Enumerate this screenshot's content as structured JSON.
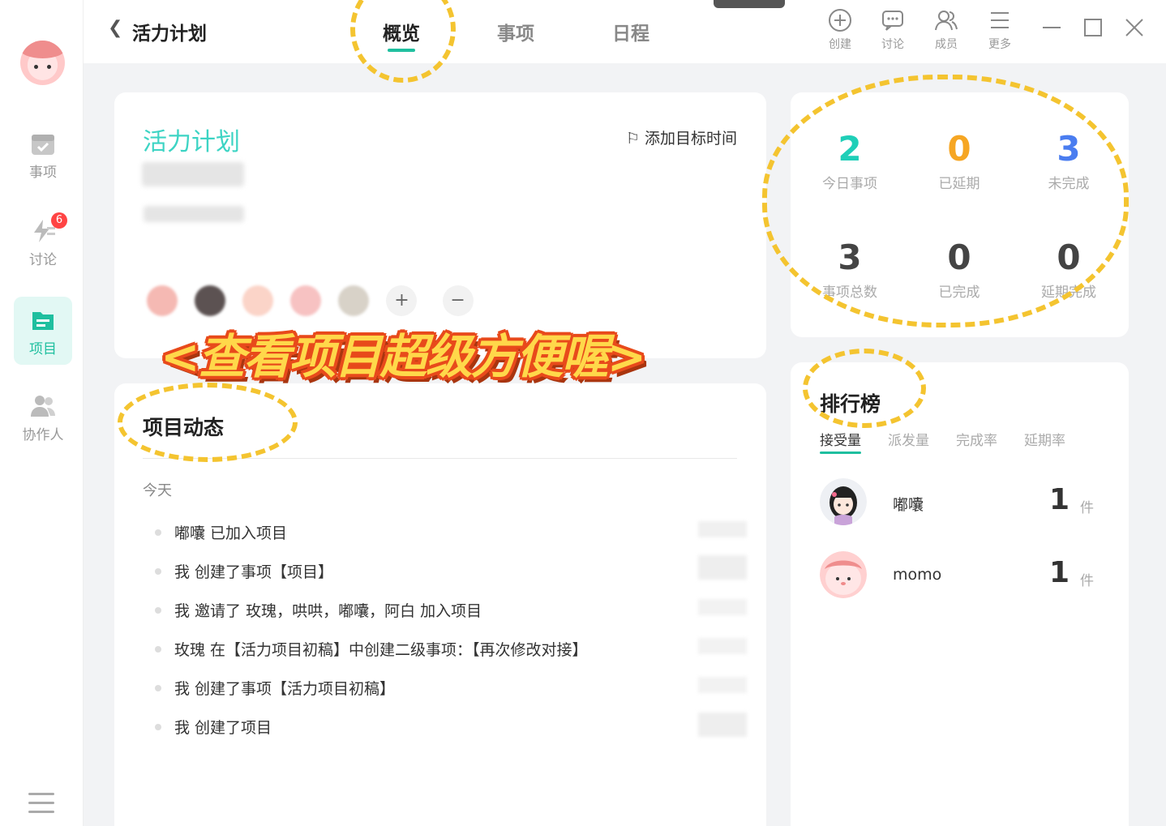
{
  "sidebar": {
    "items": [
      {
        "label": "事项",
        "badge": ""
      },
      {
        "label": "讨论",
        "badge": "6"
      },
      {
        "label": "项目",
        "badge": ""
      },
      {
        "label": "协作人",
        "badge": ""
      }
    ]
  },
  "header": {
    "project_name": "活力计划",
    "tabs": [
      "概览",
      "事项",
      "日程"
    ],
    "tools": [
      "创建",
      "讨论",
      "成员",
      "更多"
    ]
  },
  "overview": {
    "title": "活力计划",
    "add_target": "添加目标时间"
  },
  "stats": [
    {
      "value": "2",
      "label": "今日事项",
      "color": "#1fcfb8"
    },
    {
      "value": "0",
      "label": "已延期",
      "color": "#f6a623"
    },
    {
      "value": "3",
      "label": "未完成",
      "color": "#4a7df0"
    },
    {
      "value": "3",
      "label": "事项总数",
      "color": "#444444"
    },
    {
      "value": "0",
      "label": "已完成",
      "color": "#444444"
    },
    {
      "value": "0",
      "label": "延期完成",
      "color": "#444444"
    }
  ],
  "activity": {
    "title": "项目动态",
    "today": "今天",
    "items": [
      "嘟囔 已加入项目",
      "我 创建了事项【项目】",
      "我 邀请了 玫瑰，哄哄，嘟囔，阿白 加入项目",
      "玫瑰 在【活力项目初稿】中创建二级事项：【再次修改对接】",
      "我 创建了事项【活力项目初稿】",
      "我 创建了项目"
    ]
  },
  "rank": {
    "title": "排行榜",
    "tabs": [
      "接受量",
      "派发量",
      "完成率",
      "延期率"
    ],
    "rows": [
      {
        "name": "嘟囔",
        "count": "1",
        "unit": "件"
      },
      {
        "name": "momo",
        "count": "1",
        "unit": "件"
      }
    ]
  },
  "banner": "<查看项目超级方便喔>",
  "theme": {
    "accent": "#1fbf9f"
  }
}
